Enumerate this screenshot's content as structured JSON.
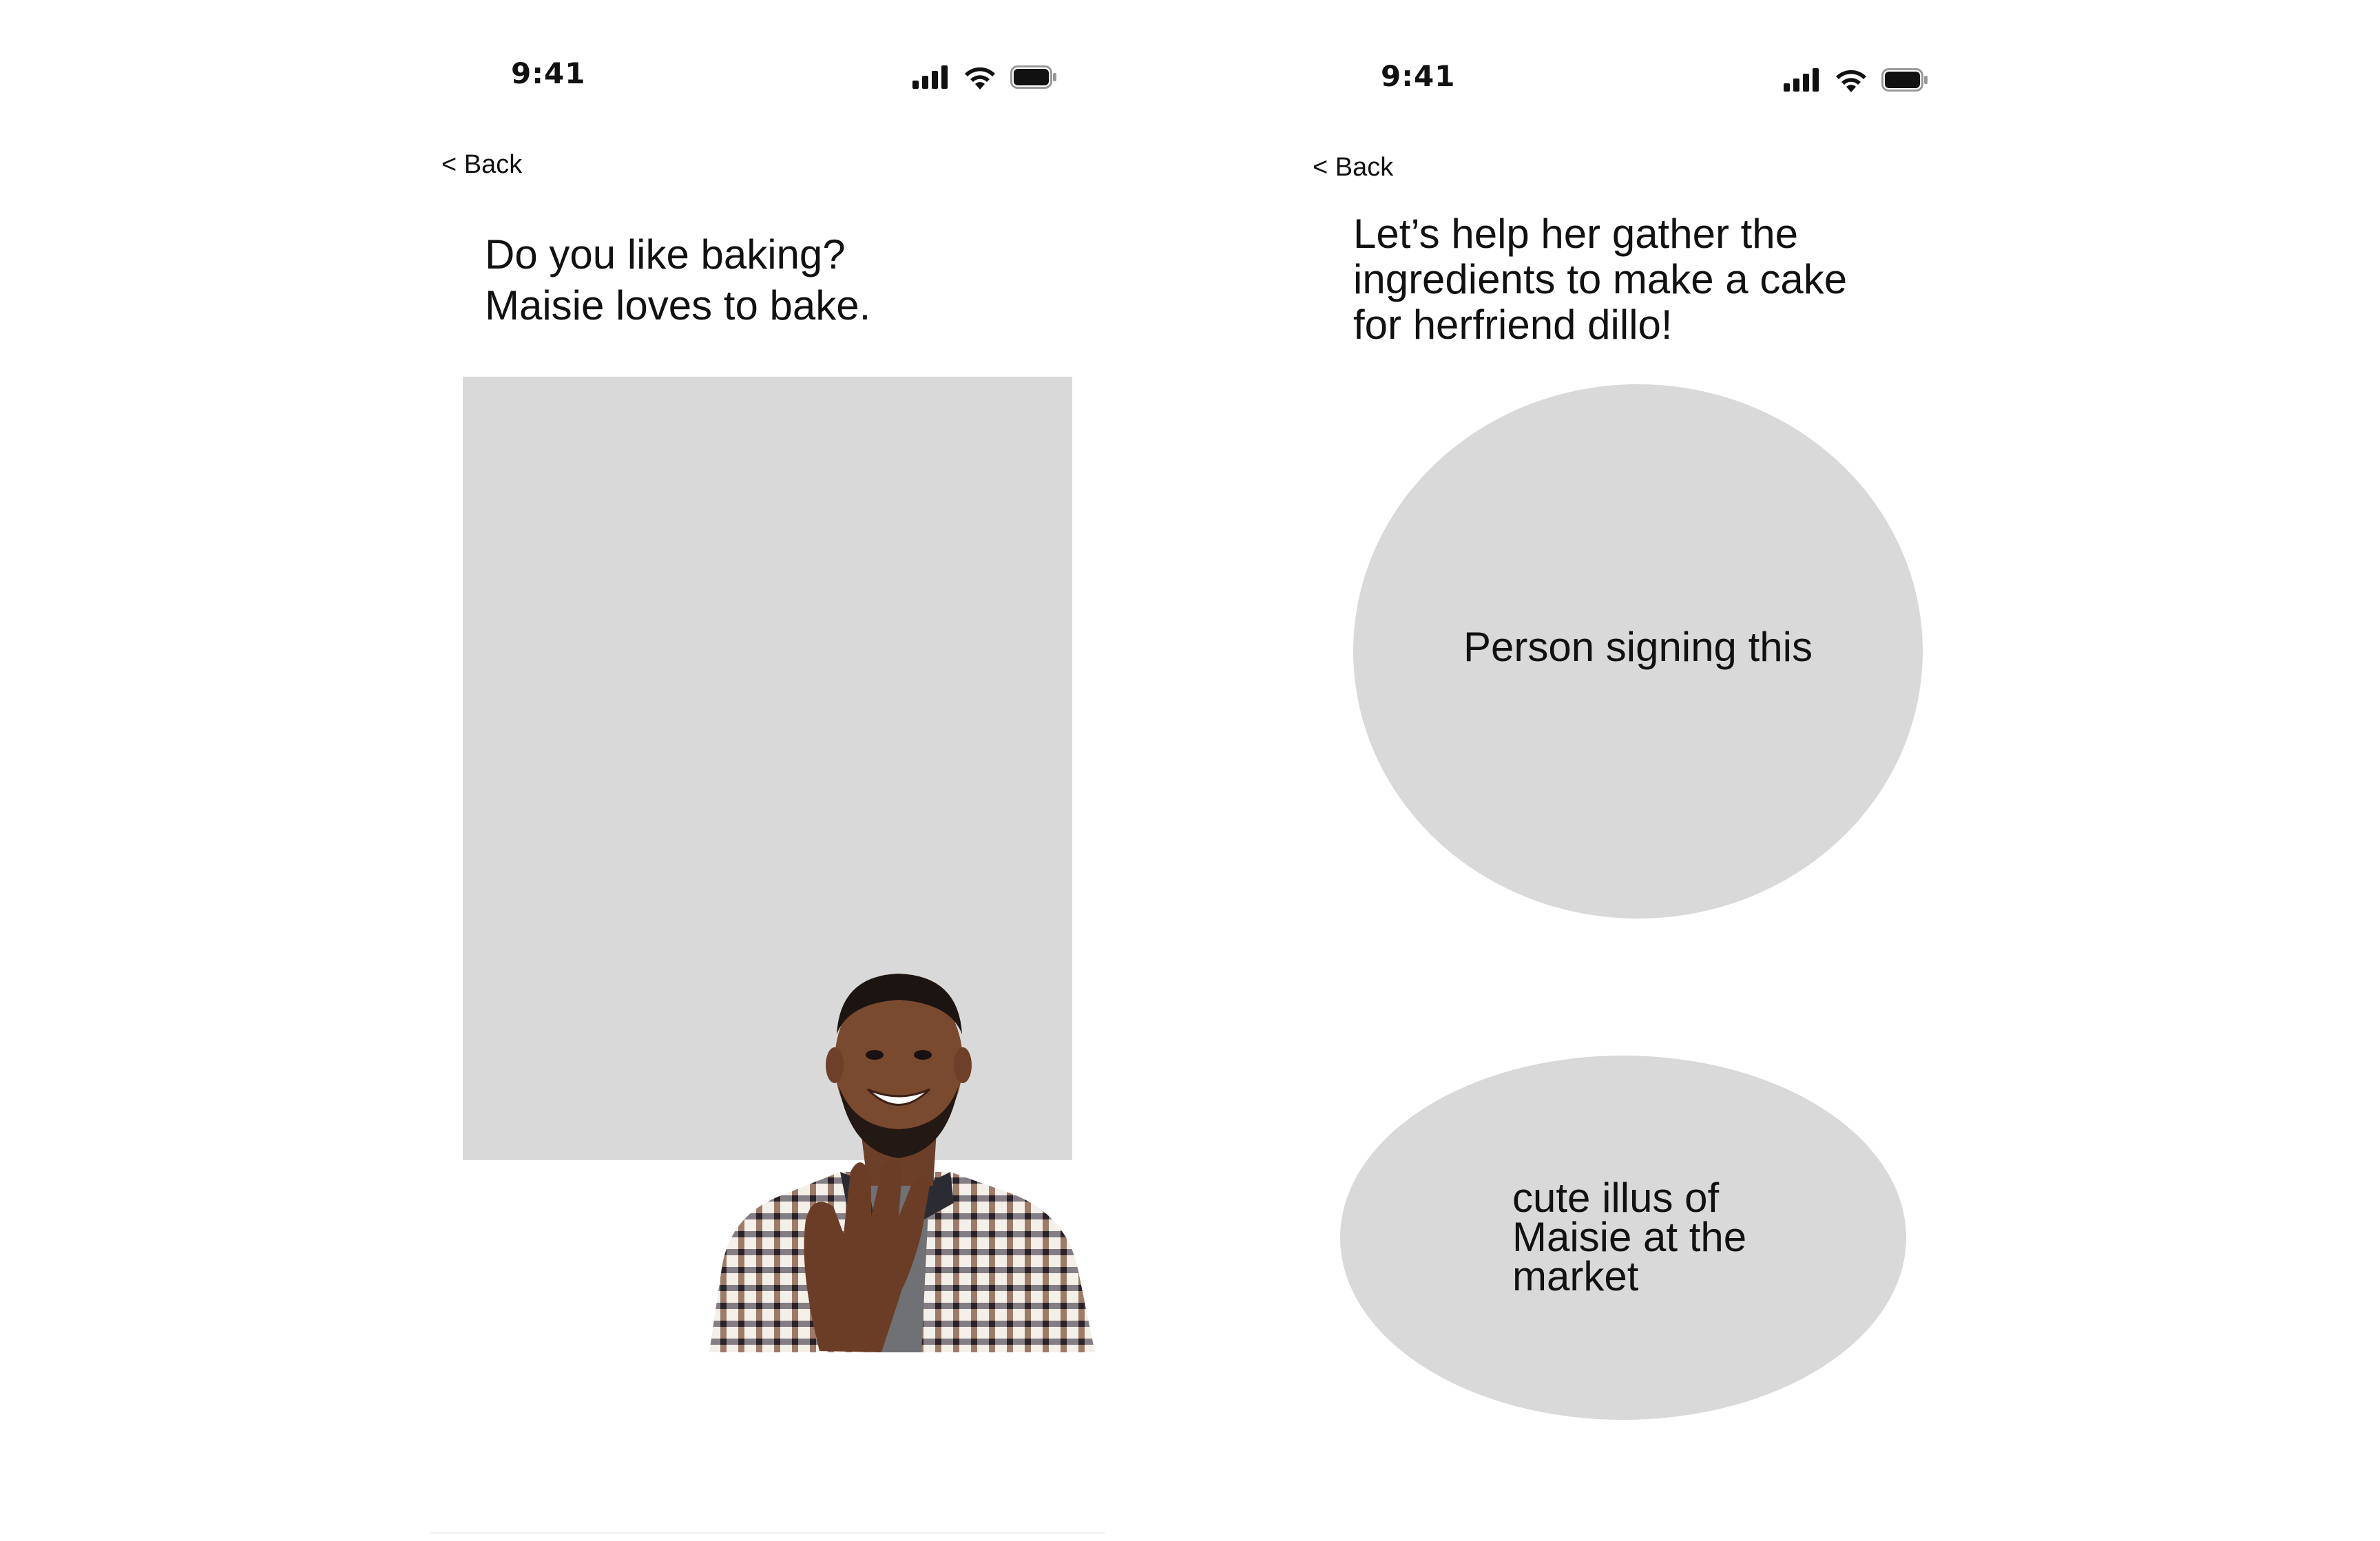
{
  "screens": [
    {
      "status_bar": {
        "time": "9:41"
      },
      "back_label": "< Back",
      "prompt": "Do you like baking?\nMaisie loves to bake."
    },
    {
      "status_bar": {
        "time": "9:41"
      },
      "back_label": "< Back",
      "prompt": "Let’s help her gather the\ningredients to make a cake\nfor herfriend dillo!",
      "bubbles": {
        "signer_text": "Person signing this",
        "illustration_text": "cute illus of\nMaisie at the\nmarket"
      }
    }
  ],
  "icons": {
    "signal": "cellular-signal-icon",
    "wifi": "wifi-icon",
    "battery": "battery-icon"
  },
  "colors": {
    "placeholder_gray": "#d9d9d9",
    "text": "#111111",
    "background": "#ffffff"
  }
}
